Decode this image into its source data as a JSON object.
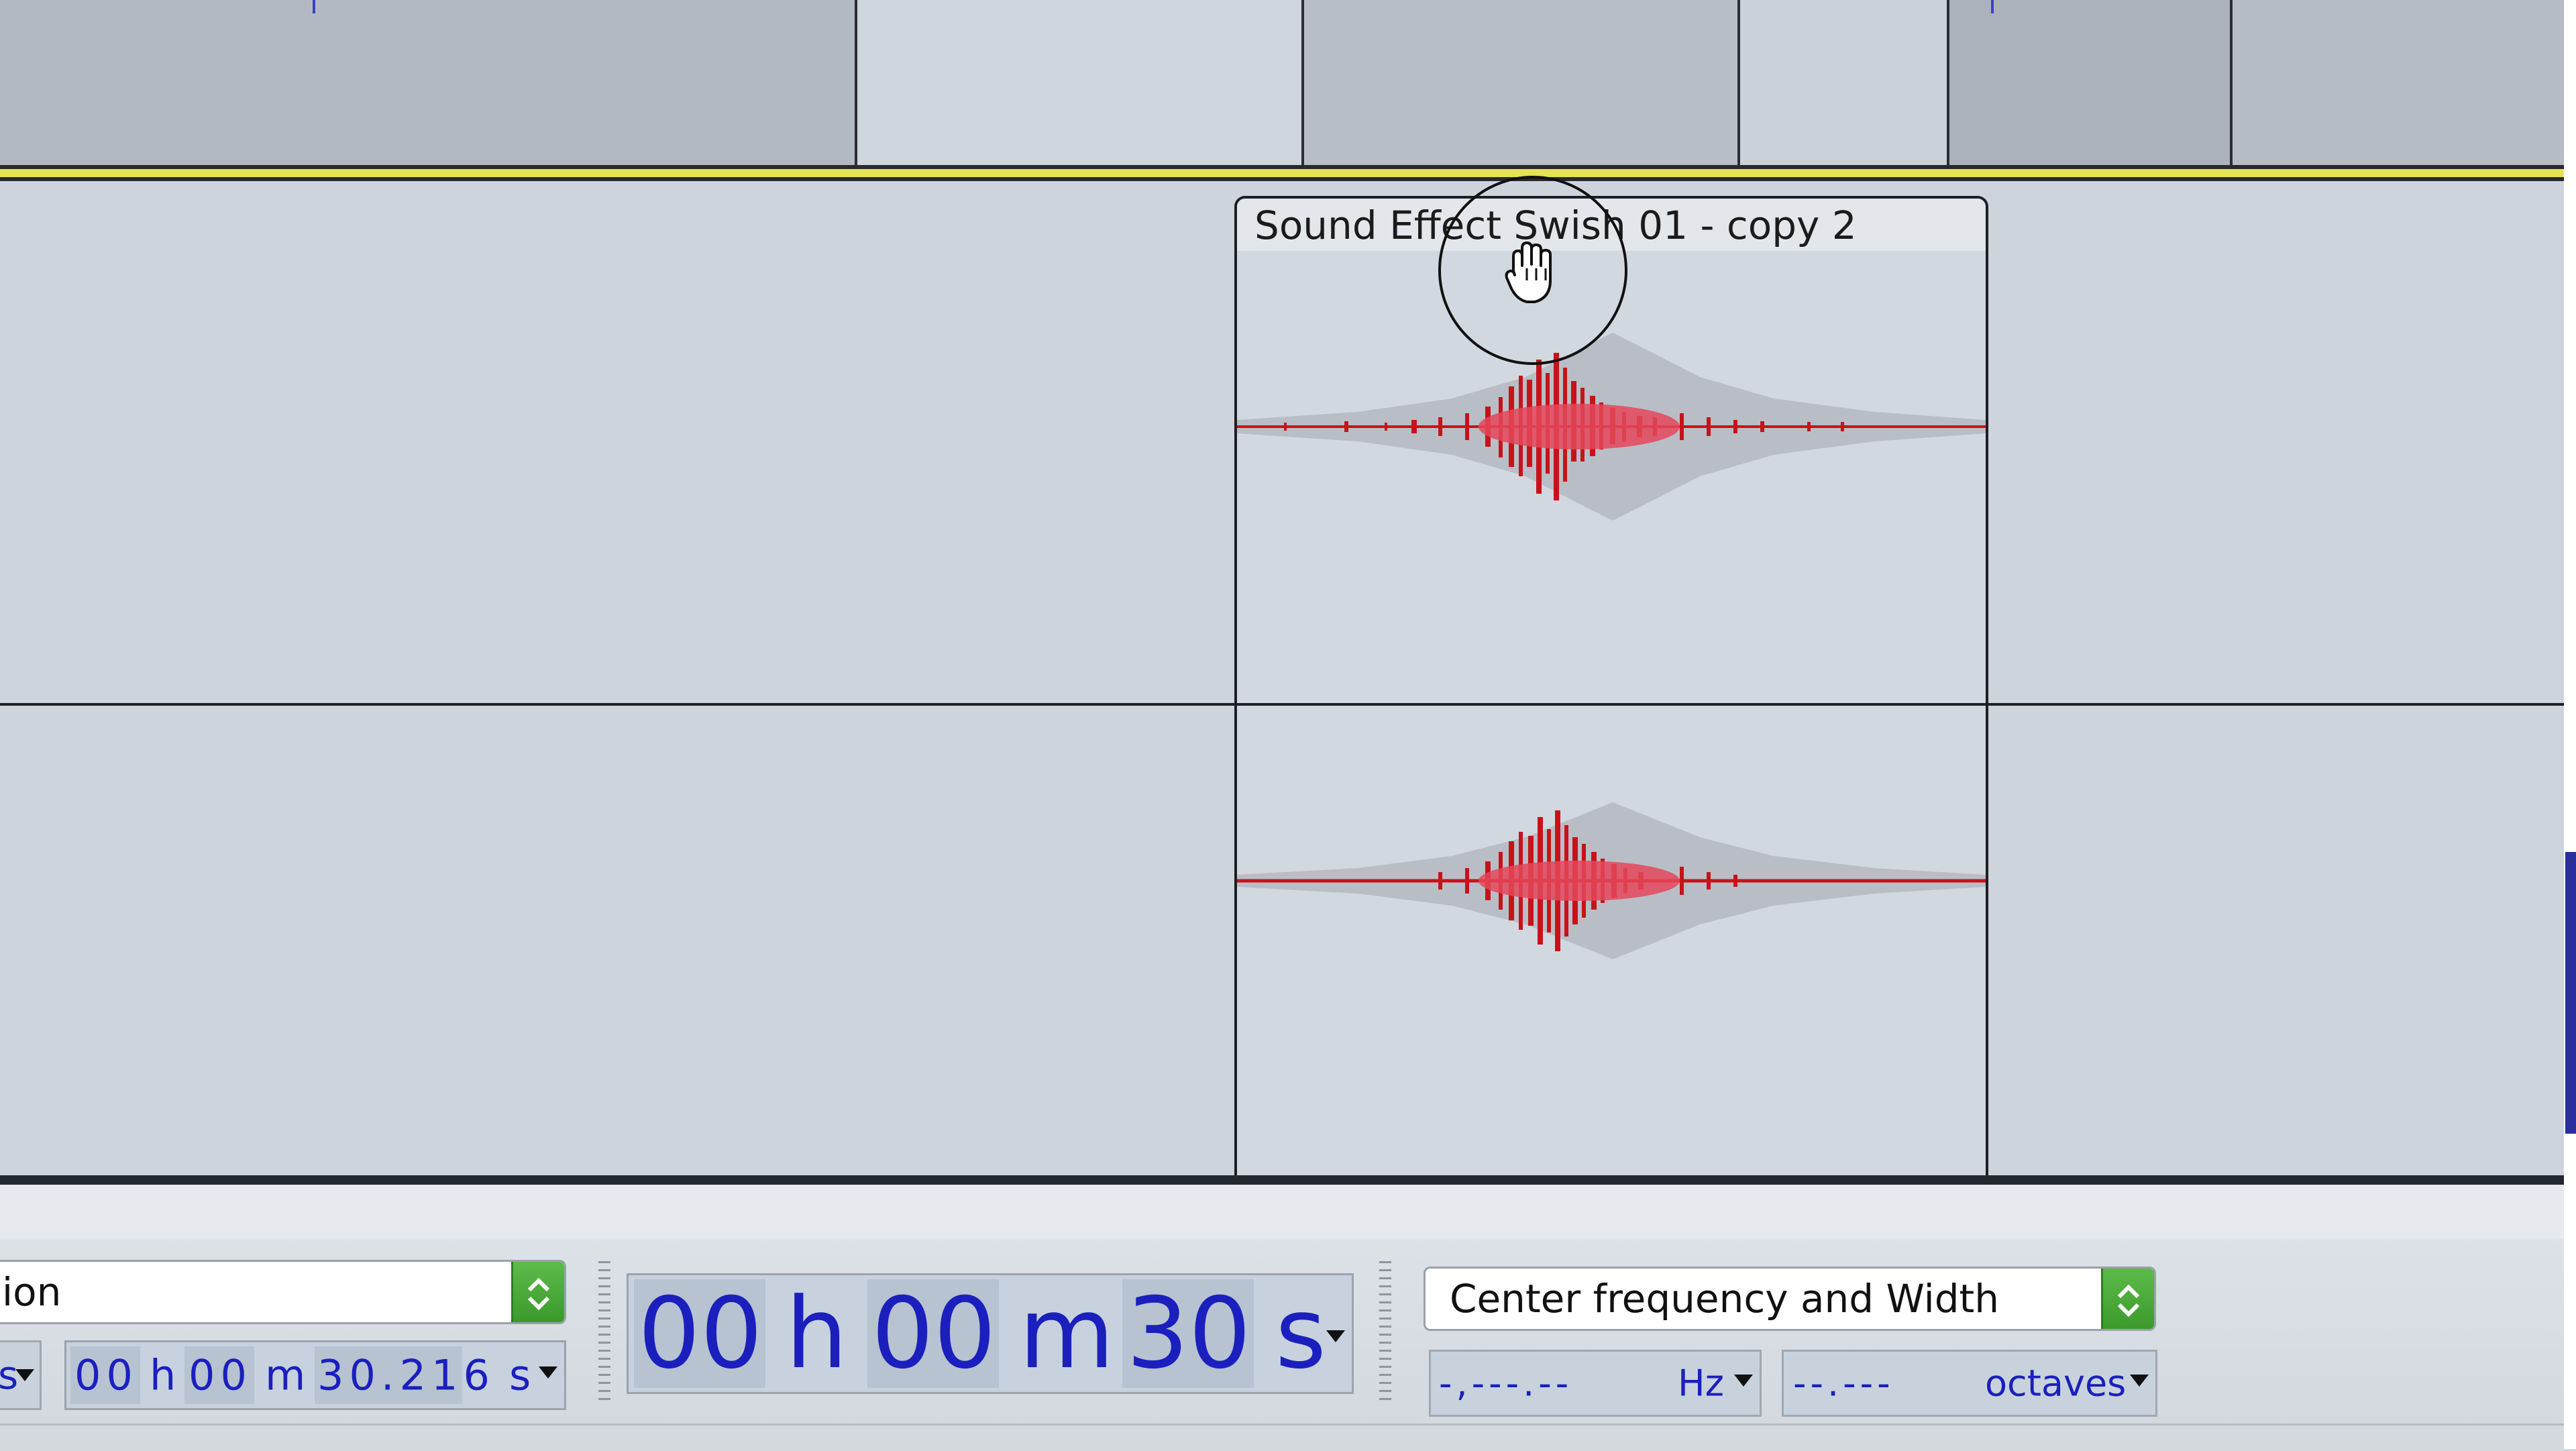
{
  "clip": {
    "title": "Sound Effect Swish 01 - copy 2"
  },
  "toolbar": {
    "left_select": {
      "value": "ion"
    },
    "left_unit_partial": "s",
    "small_time": {
      "hh": "00",
      "h": "h",
      "mm": "00",
      "m": "m",
      "ss": "30.216",
      "s": "s"
    },
    "big_time": {
      "hh": "00",
      "h": "h",
      "mm": "00",
      "m": "m",
      "ss": "30",
      "s": "s"
    },
    "mode_select": {
      "value": "Center frequency and Width"
    },
    "freq_field": {
      "value": "-,---.--",
      "unit": "Hz"
    },
    "width_field": {
      "value": "--.---",
      "unit": "octaves"
    }
  },
  "colors": {
    "waveform": "#c8121a",
    "waveform_envelope": "#b9bec6",
    "timecode": "#1b1fbe",
    "stepper": "#3a9a2b",
    "playhead_line": "#e6e456"
  },
  "icons": {
    "cursor": "hand-grab-icon",
    "stepper": "up-down-chevrons-icon",
    "dropdown": "caret-down-icon"
  }
}
